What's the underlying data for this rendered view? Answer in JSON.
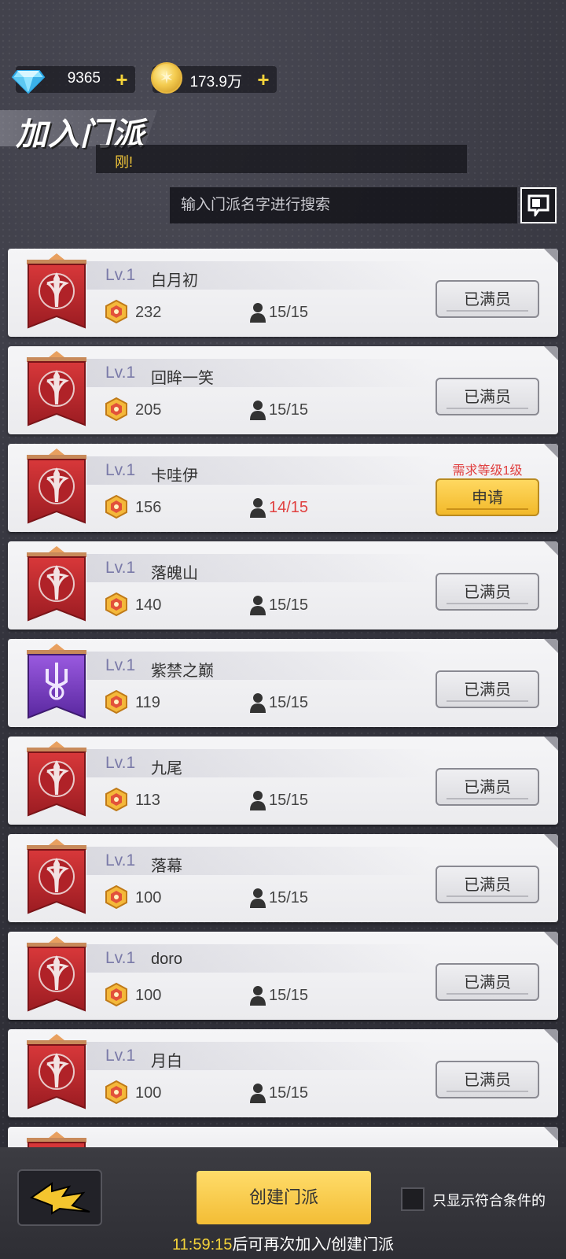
{
  "currency": {
    "gems": "9365",
    "coins": "173.9万",
    "plus": "+"
  },
  "header": {
    "title": "加入门派",
    "subtitle": "刚!"
  },
  "search": {
    "placeholder": "输入门派名字进行搜索"
  },
  "guilds": [
    {
      "level": "Lv.1",
      "name": "白月初",
      "score": "232",
      "members": "15/15",
      "button": "已满员",
      "emblem": "red-sword-banner"
    },
    {
      "level": "Lv.1",
      "name": "回眸一笑",
      "score": "205",
      "members": "15/15",
      "button": "已满员",
      "emblem": "red-sword-banner"
    },
    {
      "level": "Lv.1",
      "name": "卡哇伊",
      "score": "156",
      "members": "14/15",
      "button": "申请",
      "requirement": "需求等级1级",
      "emblem": "red-sword-banner"
    },
    {
      "level": "Lv.1",
      "name": "落魄山",
      "score": "140",
      "members": "15/15",
      "button": "已满员",
      "emblem": "red-sword-banner"
    },
    {
      "level": "Lv.1",
      "name": "紫禁之巅",
      "score": "119",
      "members": "15/15",
      "button": "已满员",
      "emblem": "purple-trident-banner"
    },
    {
      "level": "Lv.1",
      "name": "九尾",
      "score": "113",
      "members": "15/15",
      "button": "已满员",
      "emblem": "red-sword-banner"
    },
    {
      "level": "Lv.1",
      "name": "落幕",
      "score": "100",
      "members": "15/15",
      "button": "已满员",
      "emblem": "red-sword-banner"
    },
    {
      "level": "Lv.1",
      "name": "doro",
      "score": "100",
      "members": "15/15",
      "button": "已满员",
      "emblem": "red-sword-banner"
    },
    {
      "level": "Lv.1",
      "name": "月白",
      "score": "100",
      "members": "15/15",
      "button": "已满员",
      "emblem": "red-sword-banner"
    }
  ],
  "footer": {
    "create_label": "创建门派",
    "filter_label": "只显示符合条件的",
    "timer": "11:59:15",
    "timer_suffix": "后可再次加入/创建门派"
  },
  "colors": {
    "red_banner": "#c0282c",
    "purple_banner": "#7a3fc8",
    "apply_button": "#f3bd35",
    "full_member_text": "#e04040",
    "accent_yellow": "#f4d33a"
  }
}
